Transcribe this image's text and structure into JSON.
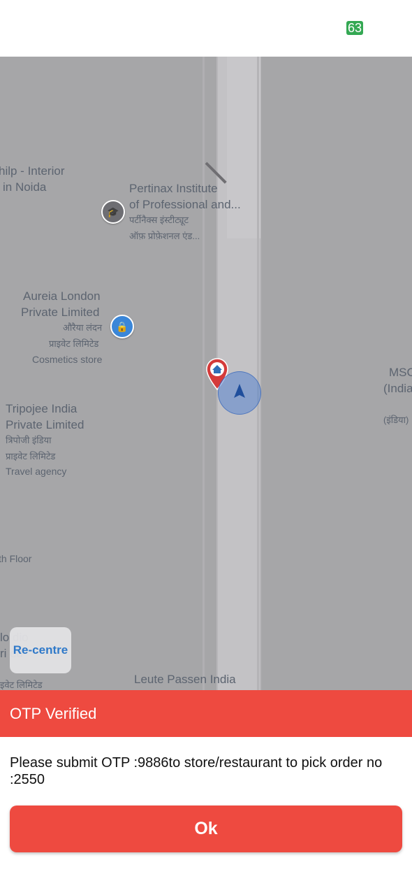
{
  "status_bar": {
    "battery_level": "63",
    "battery_color": "#34a853"
  },
  "map": {
    "labels": {
      "shilp_line1": "hilp - Interior",
      "shilp_line2": "in Noida",
      "pertinax_line1": "Pertinax Institute",
      "pertinax_line2": "of Professional and...",
      "pertinax_hi1": "पर्टीनैक्स इंस्टीट्यूट",
      "pertinax_hi2": "ऑफ़ प्रोफ़ेशनल एंड...",
      "aureia_line1": "Aureia London",
      "aureia_line2": "Private Limited",
      "aureia_hi1": "औरैया लंदन",
      "aureia_hi2": "प्राइवेट लिमिटेड",
      "aureia_category": "Cosmetics store",
      "tripojee_line1": "Tripojee India",
      "tripojee_line2": "Private Limited",
      "tripojee_hi1": "त्रिपोजी इंडिया",
      "tripojee_hi2": "प्राइवेट लिमिटेड",
      "tripojee_category": "Travel agency",
      "msc_line1": "MSC",
      "msc_line2": "(India",
      "msc_hi": "(इंडिया)",
      "floor": "th Floor",
      "studio_line1": "lo        dio",
      "studio_line2": "ri            ed",
      "studio_hi": "इवेट लिमिटेड",
      "leute": "Leute Passen India"
    },
    "icons": {
      "school": "school-icon",
      "shopping": "shopping-bag-icon",
      "destination": "home-marker-icon",
      "current_location": "navigation-arrow-icon"
    }
  },
  "recentre_label": "Re-centre",
  "otp": {
    "title": "OTP Verified",
    "message": "Please submit OTP :9886to store/restaurant to pick order no :2550",
    "ok_label": "Ok"
  },
  "colors": {
    "accent": "#ee4a40",
    "map_background": "#a6a6a8",
    "link_blue": "#2f79c9"
  }
}
